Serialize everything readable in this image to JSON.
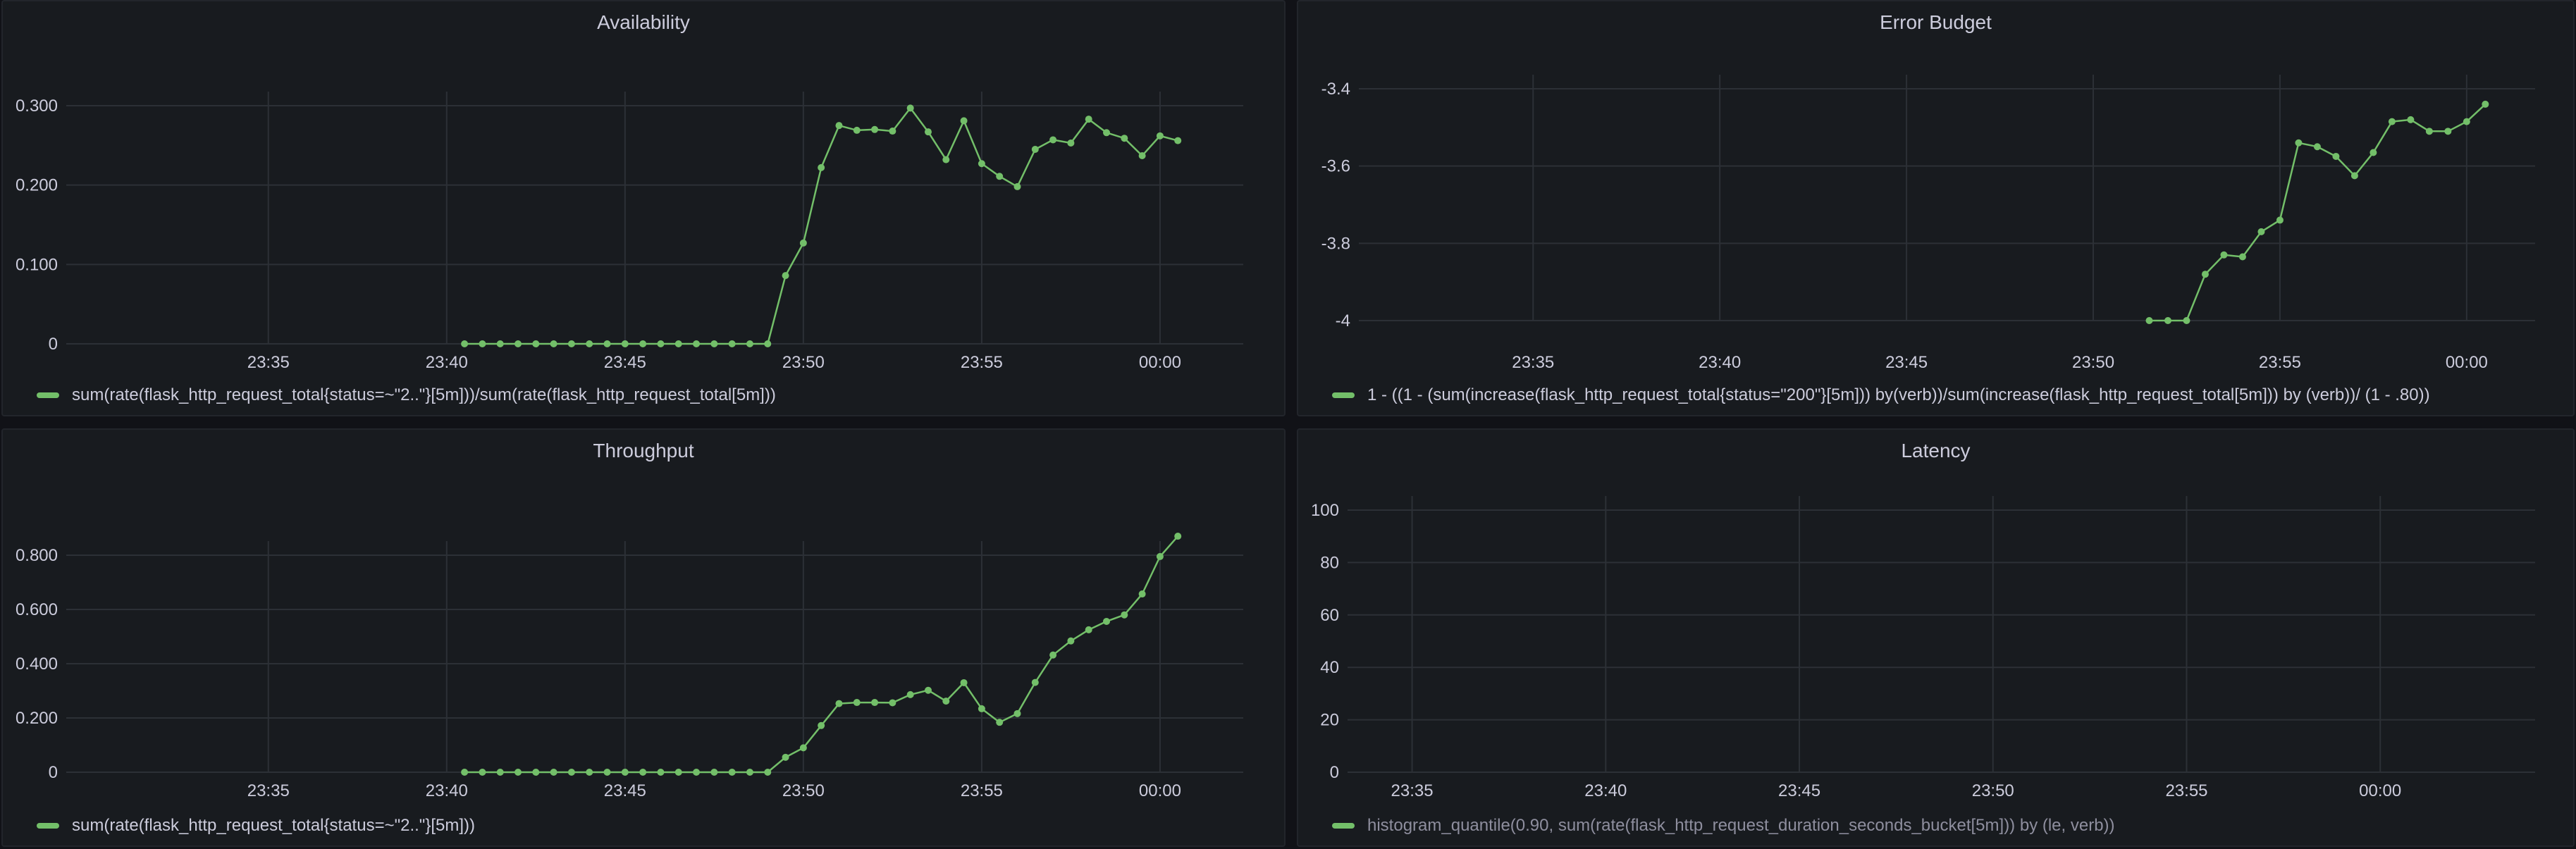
{
  "colors": {
    "background": "#111217",
    "panel": "#181b1f",
    "series": "#73bf69",
    "grid": "#2c3036"
  },
  "panels": {
    "availability": {
      "title": "Availability",
      "legend": "sum(rate(flask_http_request_total{status=~\"2..\"}[5m]))/sum(rate(flask_http_request_total[5m]))"
    },
    "error_budget": {
      "title": "Error Budget",
      "legend": "1 - ((1 - (sum(increase(flask_http_request_total{status=\"200\"}[5m])) by(verb))/sum(increase(flask_http_request_total[5m])) by (verb))/ (1 - .80))"
    },
    "throughput": {
      "title": "Throughput",
      "legend": "sum(rate(flask_http_request_total{status=~\"2..\"}[5m]))"
    },
    "latency": {
      "title": "Latency",
      "legend": "histogram_quantile(0.90, sum(rate(flask_http_request_duration_seconds_bucket[5m])) by (le, verb))"
    }
  },
  "chart_data": [
    {
      "type": "line",
      "title": "Availability",
      "x_ticks": [
        "23:35",
        "23:40",
        "23:45",
        "23:50",
        "23:55",
        "00:00"
      ],
      "y_ticks": [
        "0",
        "0.100",
        "0.200",
        "0.300"
      ],
      "ylim": [
        0,
        0.3
      ],
      "series": [
        {
          "name": "sum(rate(flask_http_request_total{status=~\"2..\"}[5m]))/sum(rate(flask_http_request_total[5m]))",
          "x": [
            "23:40:30",
            "23:41:00",
            "23:41:30",
            "23:42:00",
            "23:42:30",
            "23:43:00",
            "23:43:30",
            "23:44:00",
            "23:44:30",
            "23:45:00",
            "23:45:30",
            "23:46:00",
            "23:46:30",
            "23:47:00",
            "23:47:30",
            "23:48:00",
            "23:48:30",
            "23:49:00",
            "23:49:30",
            "23:50:00",
            "23:50:30",
            "23:51:00",
            "23:51:30",
            "23:52:00",
            "23:52:30",
            "23:53:00",
            "23:53:30",
            "23:54:00",
            "23:54:30",
            "23:55:00",
            "23:55:30",
            "23:56:00",
            "23:56:30",
            "23:57:00",
            "23:57:30",
            "23:58:00",
            "23:58:30",
            "23:59:00",
            "23:59:30",
            "00:00:00",
            "00:00:30"
          ],
          "values": [
            0,
            0,
            0,
            0,
            0,
            0,
            0,
            0,
            0,
            0,
            0,
            0,
            0,
            0,
            0,
            0,
            0,
            0,
            0.086,
            0.127,
            0.222,
            0.275,
            0.269,
            0.27,
            0.268,
            0.297,
            0.267,
            0.232,
            0.281,
            0.227,
            0.211,
            0.198,
            0.245,
            0.257,
            0.253,
            0.283,
            0.266,
            0.259,
            0.237,
            0.262,
            0.256
          ]
        }
      ]
    },
    {
      "type": "line",
      "title": "Error Budget",
      "x_ticks": [
        "23:35",
        "23:40",
        "23:45",
        "23:50",
        "23:55",
        "00:00"
      ],
      "y_ticks": [
        "-4",
        "-3.8",
        "-3.6",
        "-3.4"
      ],
      "ylim": [
        -4,
        -3.4
      ],
      "series": [
        {
          "name": "1 - ((1 - (sum(increase(flask_http_request_total{status=\"200\"}[5m])) by(verb))/sum(increase(flask_http_request_total[5m])) by (verb))/ (1 - .80))",
          "x": [
            "23:51:30",
            "23:52:00",
            "23:52:30",
            "23:53:00",
            "23:53:30",
            "23:54:00",
            "23:54:30",
            "23:55:00",
            "23:55:30",
            "23:56:00",
            "23:56:30",
            "23:57:00",
            "23:57:30",
            "23:58:00",
            "23:58:30",
            "23:59:00",
            "23:59:30",
            "00:00:00",
            "00:00:30"
          ],
          "values": [
            -4.0,
            -4.0,
            -4.0,
            -3.88,
            -3.83,
            -3.835,
            -3.77,
            -3.74,
            -3.54,
            -3.55,
            -3.575,
            -3.625,
            -3.565,
            -3.485,
            -3.48,
            -3.51,
            -3.51,
            -3.485,
            -3.44
          ]
        }
      ]
    },
    {
      "type": "line",
      "title": "Throughput",
      "x_ticks": [
        "23:35",
        "23:40",
        "23:45",
        "23:50",
        "23:55",
        "00:00"
      ],
      "y_ticks": [
        "0",
        "0.200",
        "0.400",
        "0.600",
        "0.800"
      ],
      "ylim": [
        0,
        0.8
      ],
      "series": [
        {
          "name": "sum(rate(flask_http_request_total{status=~\"2..\"}[5m]))",
          "x": [
            "23:40:30",
            "23:41:00",
            "23:41:30",
            "23:42:00",
            "23:42:30",
            "23:43:00",
            "23:43:30",
            "23:44:00",
            "23:44:30",
            "23:45:00",
            "23:45:30",
            "23:46:00",
            "23:46:30",
            "23:47:00",
            "23:47:30",
            "23:48:00",
            "23:48:30",
            "23:49:00",
            "23:49:30",
            "23:50:00",
            "23:50:30",
            "23:51:00",
            "23:51:30",
            "23:52:00",
            "23:52:30",
            "23:53:00",
            "23:53:30",
            "23:54:00",
            "23:54:30",
            "23:55:00",
            "23:55:30",
            "23:56:00",
            "23:56:30",
            "23:57:00",
            "23:57:30",
            "23:58:00",
            "23:58:30",
            "23:59:00",
            "23:59:30",
            "00:00:00",
            "00:00:30"
          ],
          "values": [
            0,
            0,
            0,
            0,
            0,
            0,
            0,
            0,
            0,
            0,
            0,
            0,
            0,
            0,
            0,
            0,
            0,
            0,
            0.055,
            0.09,
            0.172,
            0.253,
            0.257,
            0.257,
            0.256,
            0.286,
            0.302,
            0.262,
            0.33,
            0.234,
            0.184,
            0.216,
            0.331,
            0.432,
            0.484,
            0.525,
            0.556,
            0.58,
            0.657,
            0.795,
            0.87
          ]
        }
      ]
    },
    {
      "type": "line",
      "title": "Latency",
      "x_ticks": [
        "23:35",
        "23:40",
        "23:45",
        "23:50",
        "23:55",
        "00:00"
      ],
      "y_ticks": [
        "0",
        "20",
        "40",
        "60",
        "80",
        "100"
      ],
      "ylim": [
        0,
        100
      ],
      "series": [
        {
          "name": "histogram_quantile(0.90, sum(rate(flask_http_request_duration_seconds_bucket[5m])) by (le, verb))",
          "x": [],
          "values": []
        }
      ]
    }
  ]
}
